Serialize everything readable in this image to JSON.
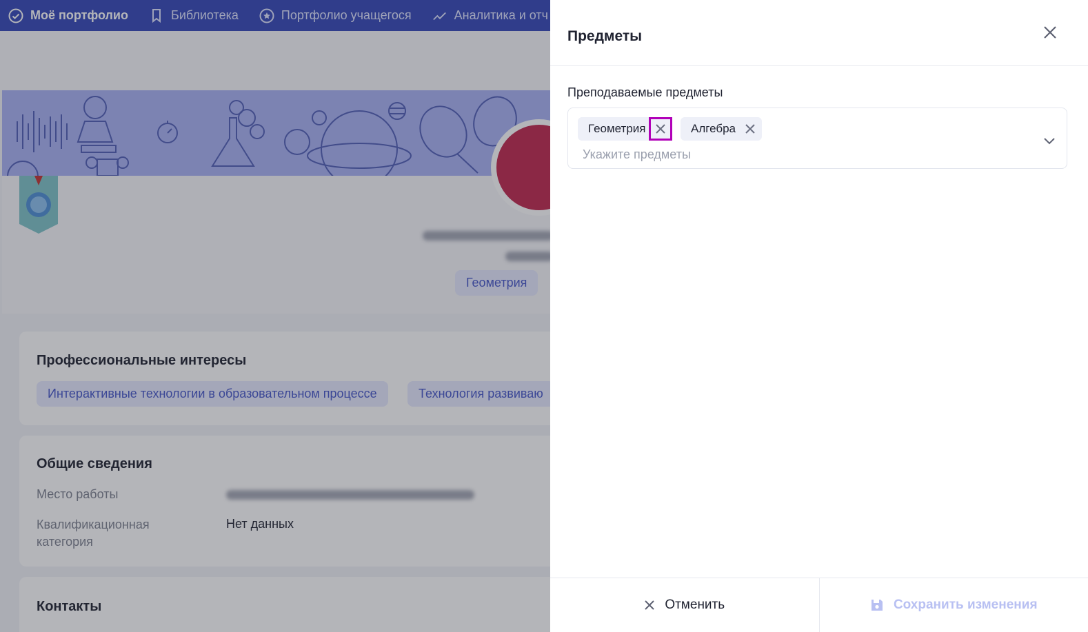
{
  "nav": {
    "items": [
      {
        "label": "Моё портфолио",
        "icon": "check-circle-icon",
        "active": true
      },
      {
        "label": "Библиотека",
        "icon": "bookmark-icon",
        "active": false
      },
      {
        "label": "Портфолио учащегося",
        "icon": "star-circle-icon",
        "active": false
      },
      {
        "label": "Аналитика и отч",
        "icon": "chart-line-icon",
        "active": false
      }
    ]
  },
  "profile": {
    "subject_tag": "Геометрия"
  },
  "interests": {
    "title": "Профессиональные интересы",
    "tags": [
      "Интерактивные технологии в образовательном процессе",
      "Технология развиваю"
    ]
  },
  "general": {
    "title": "Общие сведения",
    "workplace_label": "Место работы",
    "category_label_line1": "Квалификационная",
    "category_label_line2": "категория",
    "category_value": "Нет данных"
  },
  "contacts": {
    "title": "Контакты"
  },
  "drawer": {
    "title": "Предметы",
    "field_label": "Преподаваемые предметы",
    "chips": [
      "Геометрия",
      "Алгебра"
    ],
    "placeholder": "Укажите предметы",
    "cancel_label": "Отменить",
    "save_label": "Сохранить изменения"
  },
  "colors": {
    "nav_bg": "#3548b8",
    "accent": "#4656c9",
    "highlight": "#b100b8",
    "save_disabled": "#b8c0f2"
  }
}
